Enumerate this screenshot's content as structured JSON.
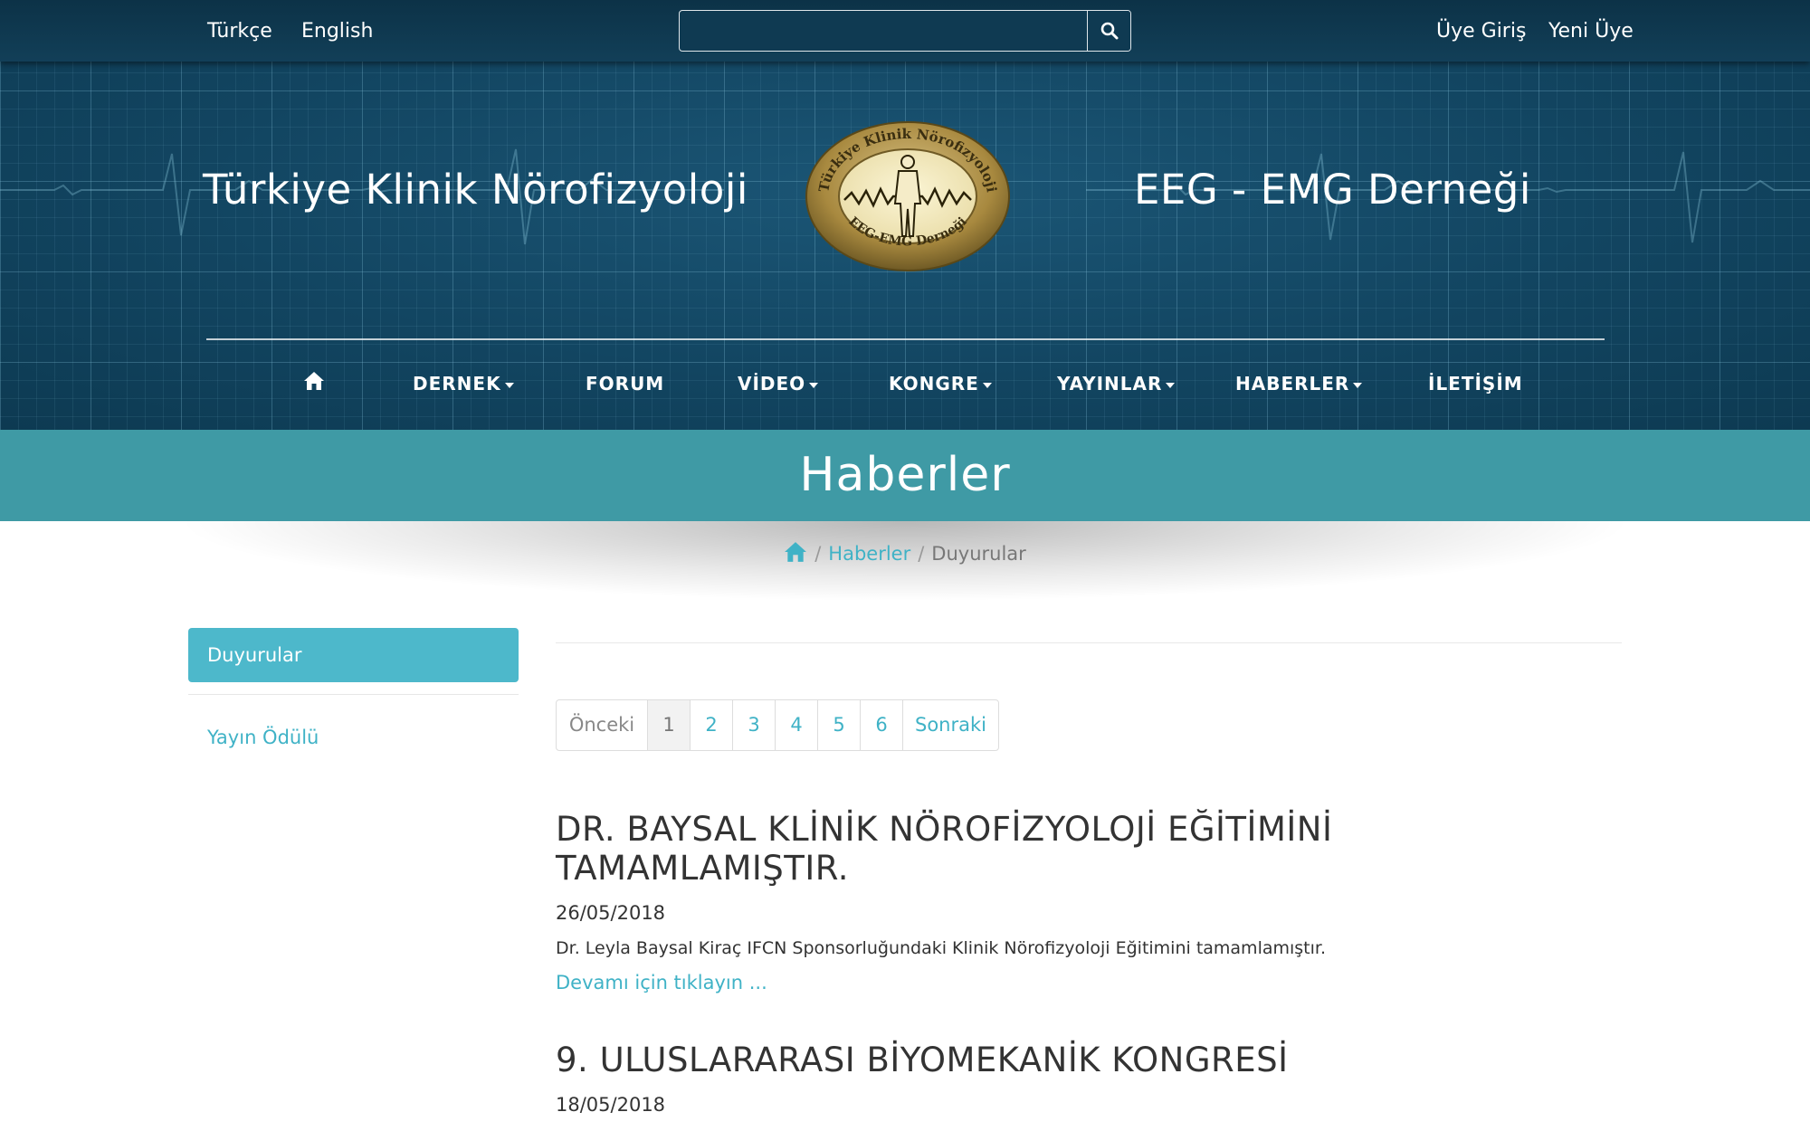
{
  "topbar": {
    "languages": [
      "Türkçe",
      "English"
    ],
    "search": {
      "value": "",
      "placeholder": ""
    },
    "login_label": "Üye Giriş",
    "register_label": "Yeni Üye"
  },
  "header": {
    "title_left": "Türkiye Klinik Nörofizyoloji",
    "title_right": "EEG - EMG Derneği",
    "logo": {
      "ring_top": "Türkiye Klinik Nörofizyoloji",
      "ring_bottom": "EEG-EMG Derneği"
    }
  },
  "nav": {
    "home_icon": "home-icon",
    "items": [
      {
        "label": "DERNEK",
        "dropdown": true
      },
      {
        "label": "FORUM",
        "dropdown": false
      },
      {
        "label": "VİDEO",
        "dropdown": true
      },
      {
        "label": "KONGRE",
        "dropdown": true
      },
      {
        "label": "YAYINLAR",
        "dropdown": true
      },
      {
        "label": "HABERLER",
        "dropdown": true
      },
      {
        "label": "İLETİŞİM",
        "dropdown": false
      }
    ]
  },
  "page": {
    "title": "Haberler",
    "breadcrumb": {
      "home_icon": "home-icon",
      "items": [
        "Haberler",
        "Duyurular"
      ]
    }
  },
  "sidebar": {
    "items": [
      {
        "label": "Duyurular",
        "active": true
      },
      {
        "label": "Yayın Ödülü",
        "active": false
      }
    ]
  },
  "pagination": {
    "prev_label": "Önceki",
    "pages": [
      "1",
      "2",
      "3",
      "4",
      "5",
      "6"
    ],
    "current": "1",
    "next_label": "Sonraki"
  },
  "news": [
    {
      "title": "DR. BAYSAL KLİNİK NÖROFİZYOLOJİ EĞİTİMİNİ TAMAMLAMIŞTIR.",
      "date": "26/05/2018",
      "summary": "Dr. Leyla Baysal Kiraç IFCN Sponsorluğundaki Klinik Nörofizyoloji Eğitimini tamamlamıştır.",
      "more_label": "Devamı için tıklayın ..."
    },
    {
      "title": "9. ULUSLARARASI BİYOMEKANİK KONGRESİ",
      "date": "18/05/2018"
    }
  ],
  "colors": {
    "header_bg": "#124561",
    "accent": "#3fb2c6",
    "band": "#3f9aa5",
    "sidebar_active": "#4db8cb",
    "logo_gold": "#b89a52"
  }
}
